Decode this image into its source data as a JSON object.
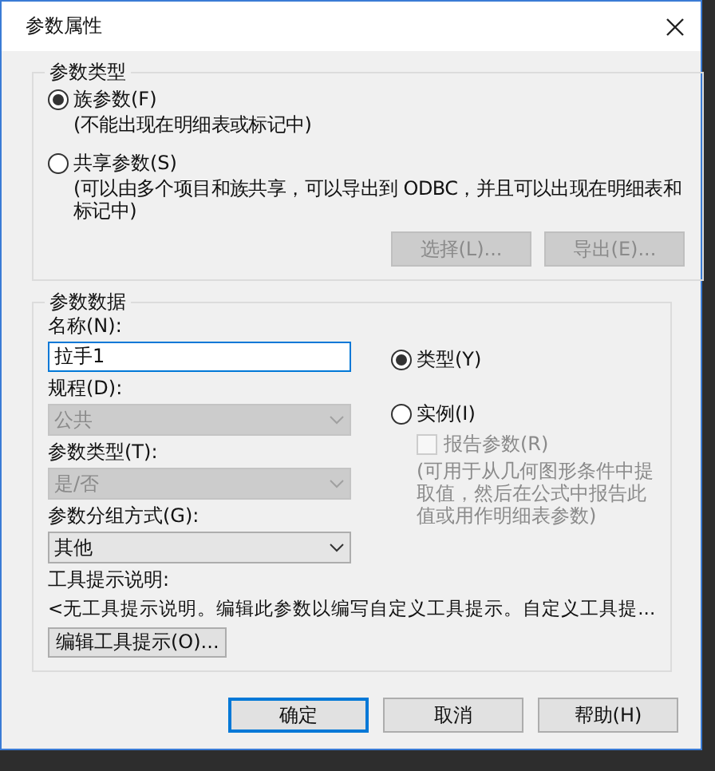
{
  "window": {
    "title": "参数属性"
  },
  "parameter_type": {
    "legend": "参数类型",
    "options": [
      {
        "label": "族参数(F)",
        "note": "(不能出现在明细表或标记中)",
        "selected": true
      },
      {
        "label": "共享参数(S)",
        "note": "(可以由多个项目和族共享，可以导出到 ODBC，并且可以出现在明细表和标记中)",
        "selected": false
      }
    ],
    "buttons": [
      {
        "label": "选择(L)...",
        "disabled": true
      },
      {
        "label": "导出(E)...",
        "disabled": true
      }
    ]
  },
  "parameter_data": {
    "legend": "参数数据",
    "name": {
      "label": "名称(N):",
      "value": "拉手1"
    },
    "fields": [
      {
        "label": "规程(D):",
        "value": "公共",
        "disabled": true
      },
      {
        "label": "参数类型(T):",
        "value": "是/否",
        "disabled": true
      },
      {
        "label": "参数分组方式(G):",
        "value": "其他",
        "disabled": false
      }
    ],
    "scope": [
      {
        "label": "类型(Y)",
        "selected": true
      },
      {
        "label": "实例(I)",
        "selected": false
      }
    ],
    "report": {
      "label": "报告参数(R)",
      "checked": false,
      "disabled": true
    },
    "report_note": "(可用于从几何图形条件中提取值，然后在公式中报告此值或用作明细表参数)",
    "tooltip_label": "工具提示说明:",
    "tooltip_text": "<无工具提示说明。编辑此参数以编写自定义工具提示。自定义工具提...",
    "edit_tooltip_button": "编辑工具提示(O)..."
  },
  "buttons": [
    {
      "label": "确定",
      "default": true
    },
    {
      "label": "取消",
      "default": false
    },
    {
      "label": "帮助(H)",
      "default": false
    }
  ]
}
